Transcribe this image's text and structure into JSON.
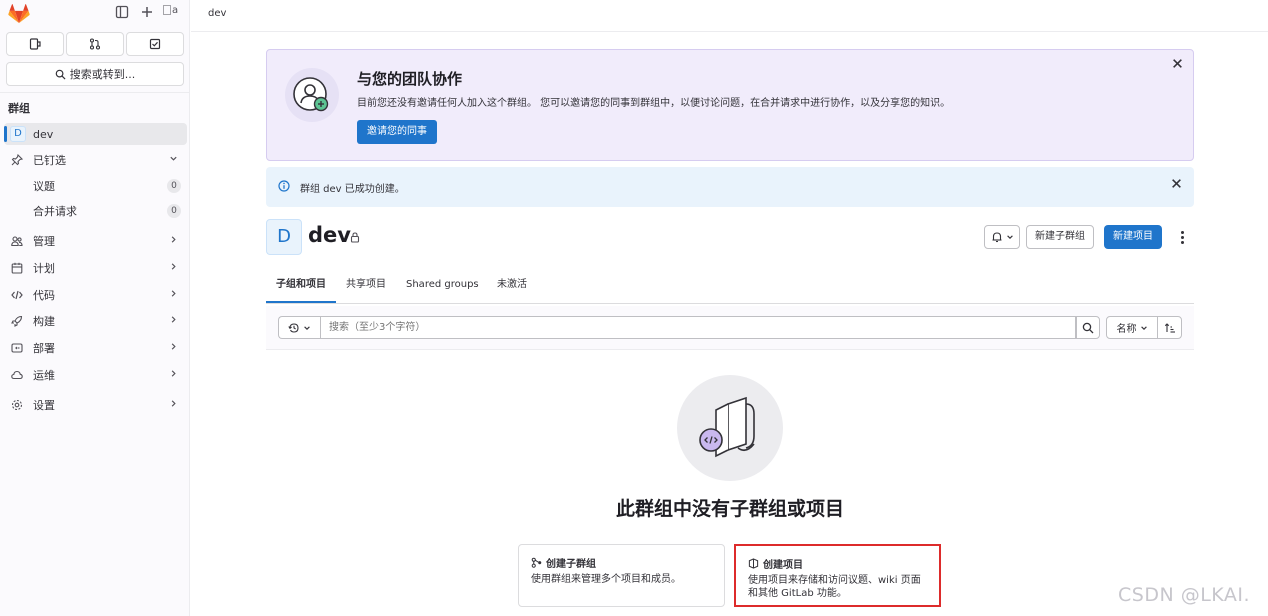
{
  "sidebar": {
    "section_title": "群组",
    "search_label": "搜索或转到...",
    "group_item": {
      "avatar_letter": "D",
      "label": "dev"
    },
    "pinned": {
      "label": "已钉选",
      "items": [
        {
          "label": "议题",
          "count": "0"
        },
        {
          "label": "合并请求",
          "count": "0"
        }
      ]
    },
    "nav": [
      {
        "label": "管理"
      },
      {
        "label": "计划"
      },
      {
        "label": "代码"
      },
      {
        "label": "构建"
      },
      {
        "label": "部署"
      },
      {
        "label": "运维"
      },
      {
        "label": "设置"
      }
    ],
    "avatar_alt": "a"
  },
  "header": {
    "breadcrumb": "dev"
  },
  "banner": {
    "title": "与您的团队协作",
    "text": "目前您还没有邀请任何人加入这个群组。 您可以邀请您的同事到群组中，以便讨论问题，在合并请求中进行协作，以及分享您的知识。",
    "button": "邀请您的同事"
  },
  "alert": {
    "text": "群组 dev 已成功创建。"
  },
  "group": {
    "avatar_letter": "D",
    "name": "dev",
    "new_subgroup_button": "新建子群组",
    "new_project_button": "新建项目"
  },
  "tabs": [
    {
      "label": "子组和项目"
    },
    {
      "label": "共享项目"
    },
    {
      "label": "Shared groups"
    },
    {
      "label": "未激活"
    }
  ],
  "filter": {
    "placeholder": "搜索（至少3个字符）",
    "sort_label": "名称"
  },
  "empty_state": {
    "title": "此群组中没有子群组或项目",
    "cards": [
      {
        "title": "创建子群组",
        "desc": "使用群组来管理多个项目和成员。"
      },
      {
        "title": "创建项目",
        "desc": "使用项目来存储和访问议题、wiki 页面和其他 GitLab 功能。"
      }
    ]
  },
  "watermark": "CSDN @LKAI.",
  "colors": {
    "accent": "#1f75cb",
    "banner_bg": "#f1ecfb",
    "alert_bg": "#e9f3fc",
    "highlight": "#dd2b2b"
  }
}
